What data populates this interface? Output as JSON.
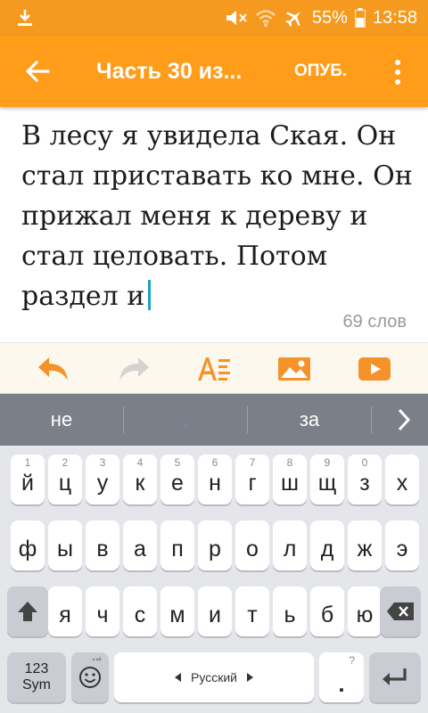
{
  "status_bar": {
    "battery": "55%",
    "time": "13:58"
  },
  "app_bar": {
    "title": "Часть 30 из...",
    "publish_label": "ОПУБ."
  },
  "editor": {
    "text": "В лесу я увидела Ская. Он стал приставать ко мне. Он прижал меня к дереву и стал целовать. Потом раздел и"
  },
  "word_count": "69 слов",
  "toolbar": {
    "buttons": [
      "undo-icon",
      "redo-icon",
      "text-format-icon",
      "image-icon",
      "video-icon"
    ]
  },
  "suggestions": [
    "не",
    ",",
    "за"
  ],
  "keyboard": {
    "row1": [
      {
        "key": "й",
        "hint": "1"
      },
      {
        "key": "ц",
        "hint": "2"
      },
      {
        "key": "у",
        "hint": "3"
      },
      {
        "key": "к",
        "hint": "4"
      },
      {
        "key": "е",
        "hint": "5"
      },
      {
        "key": "н",
        "hint": "6"
      },
      {
        "key": "г",
        "hint": "7"
      },
      {
        "key": "ш",
        "hint": "8"
      },
      {
        "key": "щ",
        "hint": "9"
      },
      {
        "key": "з",
        "hint": "0"
      },
      {
        "key": "х",
        "hint": ""
      }
    ],
    "row2": [
      "ф",
      "ы",
      "в",
      "а",
      "п",
      "р",
      "о",
      "л",
      "д",
      "ж",
      "э"
    ],
    "row3": [
      "я",
      "ч",
      "с",
      "м",
      "и",
      "т",
      "ь",
      "б",
      "ю"
    ],
    "sym_label_1": "123",
    "sym_label_2": "Sym",
    "space_label": "Русский",
    "period_key": ".",
    "period_hint": "?"
  },
  "colors": {
    "accent": "#ff9c1a",
    "status_bar": "#f59a1e",
    "cursor": "#1aa3c0",
    "suggestion_bar": "#7b7f87"
  }
}
